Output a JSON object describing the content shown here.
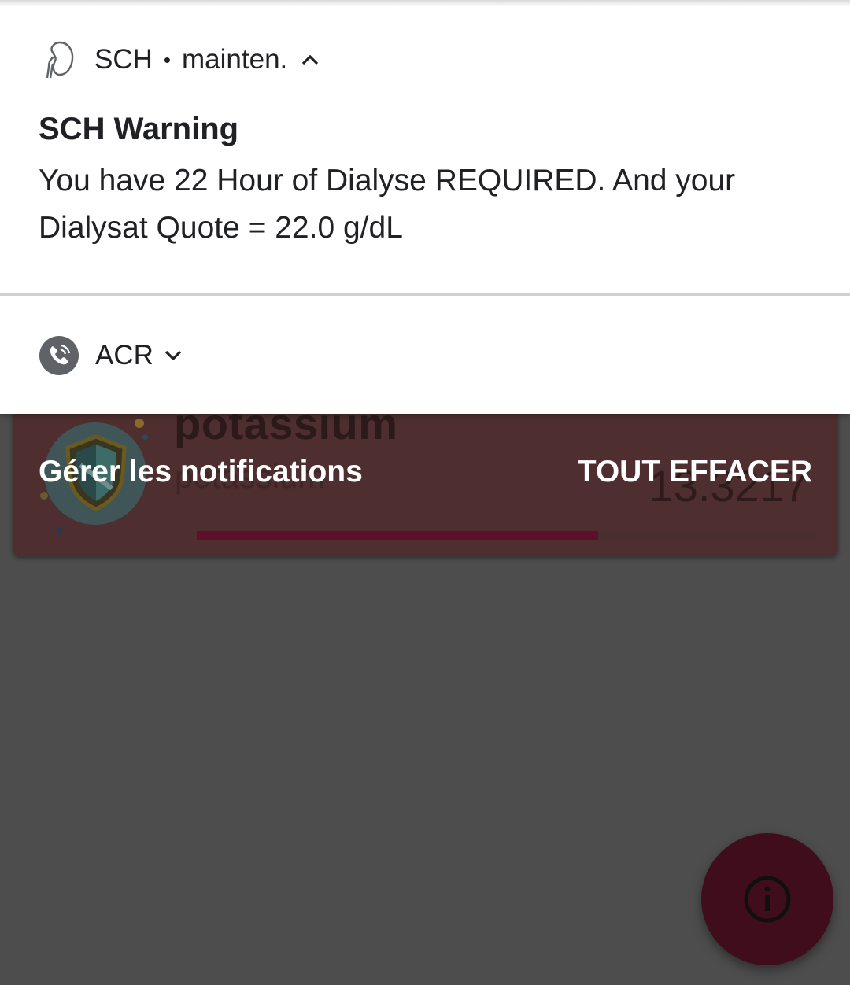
{
  "background_app": {
    "card_title": "potassium",
    "card_subtitle": "potassium",
    "card_value": "13.3217",
    "progress": 0.65,
    "accent_color": "#5d0f2b",
    "shield_icon": "shield-icon",
    "fab_icon": "info-icon"
  },
  "notifications": [
    {
      "app_icon": "kidney-icon",
      "app_name": "SCH",
      "channel": "mainten.",
      "expanded": true,
      "title": "SCH Warning",
      "body": "You have 22 Hour of Dialyse REQUIRED. And your Dialysat Quote = 22.0 g/dL"
    },
    {
      "app_icon": "phone-icon",
      "app_name": "ACR",
      "expanded": false
    }
  ],
  "footer": {
    "manage_label": "Gérer les notifications",
    "clear_all_label": "TOUT EFFACER"
  }
}
